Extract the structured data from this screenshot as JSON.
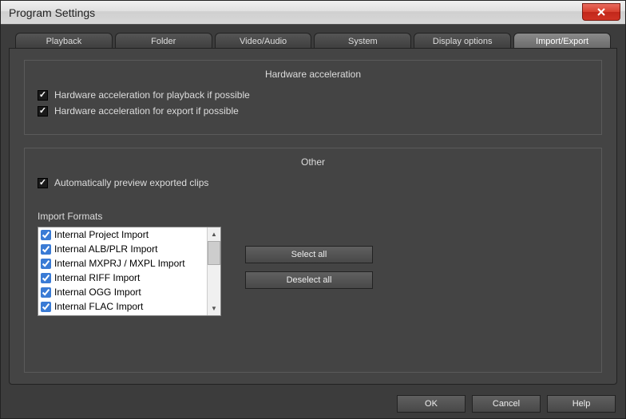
{
  "window": {
    "title": "Program Settings"
  },
  "tabs": {
    "playback": "Playback",
    "folder": "Folder",
    "video_audio": "Video/Audio",
    "system": "System",
    "display_options": "Display options",
    "import_export": "Import/Export"
  },
  "hw": {
    "title": "Hardware acceleration",
    "playback": "Hardware acceleration for playback if possible",
    "export": "Hardware acceleration for export if possible"
  },
  "other": {
    "title": "Other",
    "auto_preview": "Automatically preview exported clips",
    "formats_label": "Import Formats",
    "items": [
      "Internal Project Import",
      "Internal ALB/PLR Import",
      "Internal MXPRJ / MXPL Import",
      "Internal RIFF Import",
      "Internal OGG Import",
      "Internal FLAC Import"
    ],
    "select_all": "Select all",
    "deselect_all": "Deselect all"
  },
  "footer": {
    "ok": "OK",
    "cancel": "Cancel",
    "help": "Help"
  }
}
